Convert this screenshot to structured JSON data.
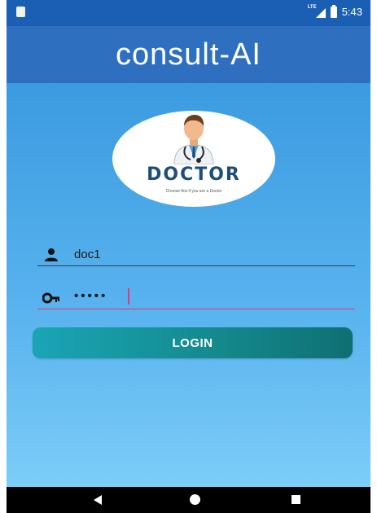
{
  "status_bar": {
    "time": "5:43",
    "network_label": "LTE",
    "icons": [
      "notification-icon",
      "signal-icon",
      "battery-icon"
    ]
  },
  "app_bar": {
    "title": "consult-AI"
  },
  "role_card": {
    "label": "DOCTOR",
    "caption": "Choose this if you are a Doctor",
    "icon": "doctor-icon"
  },
  "form": {
    "username": {
      "value": "doc1",
      "icon": "person-icon"
    },
    "password": {
      "value": "•••••",
      "icon": "key-icon"
    },
    "login_label": "LOGIN"
  },
  "nav_bar": {
    "icons": [
      "back-icon",
      "home-icon",
      "recents-icon"
    ]
  },
  "colors": {
    "status_bar": "#1a5fb4",
    "app_bar": "#2f6fc0",
    "content_top": "#3b9be0",
    "content_bottom": "#7ccdf8",
    "button_start": "#1aa5b5",
    "button_end": "#0f6f73",
    "focus_underline": "#e0367a"
  }
}
